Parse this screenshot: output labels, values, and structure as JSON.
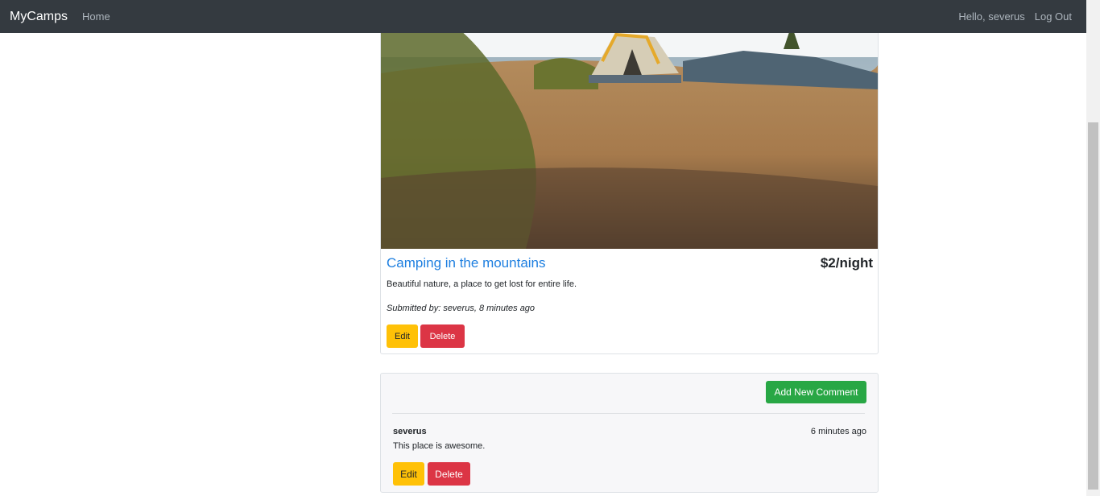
{
  "navbar": {
    "brand": "MyCamps",
    "home": "Home",
    "greeting": "Hello, severus",
    "logout": "Log Out"
  },
  "campground": {
    "title": "Camping in the mountains",
    "price": "$2/night",
    "description": "Beautiful nature, a place to get lost for entire life.",
    "submitted": "Submitted by: severus, 8 minutes ago",
    "edit_label": "Edit",
    "delete_label": "Delete"
  },
  "comments": {
    "add_label": "Add New Comment",
    "items": [
      {
        "author": "severus",
        "time": "6 minutes ago",
        "text": "This place is awesome.",
        "edit_label": "Edit",
        "delete_label": "Delete"
      }
    ]
  },
  "colors": {
    "navbar": "#343a40",
    "title_link": "#1e7fe0",
    "warning": "#ffc107",
    "danger": "#dc3545",
    "success": "#28a745"
  }
}
